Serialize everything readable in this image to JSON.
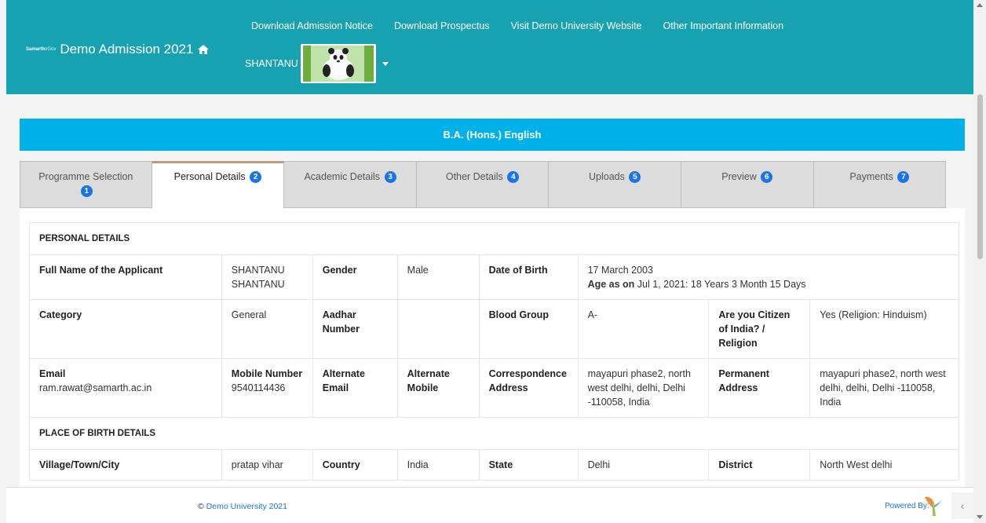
{
  "header": {
    "logo_prefix": "Samarth",
    "logo_suffix": "eGov",
    "title": "Demo Admission 2021",
    "nav": [
      "Download Admission Notice",
      "Download Prospectus",
      "Visit Demo University Website",
      "Other Important Information"
    ],
    "username": "SHANTANU"
  },
  "program": {
    "title": "B.A. (Hons.) English"
  },
  "tabs": [
    {
      "label": "Programme Selection",
      "badge": "1",
      "active": false
    },
    {
      "label": "Personal Details",
      "badge": "2",
      "active": true
    },
    {
      "label": "Academic Details",
      "badge": "3",
      "active": false
    },
    {
      "label": "Other Details",
      "badge": "4",
      "active": false
    },
    {
      "label": "Uploads",
      "badge": "5",
      "active": false
    },
    {
      "label": "Preview",
      "badge": "6",
      "active": false
    },
    {
      "label": "Payments",
      "badge": "7",
      "active": false
    }
  ],
  "personal": {
    "section_title": "PERSONAL DETAILS",
    "full_name_label": "Full Name of the Applicant",
    "full_name_value": "SHANTANU SHANTANU",
    "gender_label": "Gender",
    "gender_value": "Male",
    "dob_label": "Date of Birth",
    "dob_value": "17 March 2003",
    "age_label": "Age as on",
    "age_value": "Jul 1, 2021: 18 Years 3 Month 15 Days",
    "category_label": "Category",
    "category_value": "General",
    "aadhar_label": "Aadhar Number",
    "aadhar_value": "",
    "blood_label": "Blood Group",
    "blood_value": "A-",
    "citizen_label": "Are you Citizen of India? / Religion",
    "citizen_value": "Yes (Religion: Hinduism)",
    "email_label": "Email",
    "email_value": "ram.rawat@samarth.ac.in",
    "mobile_label": "Mobile Number",
    "mobile_value": "9540114436",
    "alt_email_label": "Alternate Email",
    "alt_mobile_label": "Alternate Mobile",
    "corr_label": "Correspondence Address",
    "corr_value": "mayapuri phase2, north west delhi, delhi, Delhi -110058, India",
    "perm_label": "Permanent Address",
    "perm_value": "mayapuri phase2, north west delhi, delhi, Delhi -110058, India"
  },
  "birth": {
    "section_title": "PLACE OF BIRTH DETAILS",
    "village_label": "Village/Town/City",
    "village_value": "pratap vihar",
    "country_label": "Country",
    "country_value": "India",
    "state_label": "State",
    "state_value": "Delhi",
    "district_label": "District",
    "district_value": "North West delhi"
  },
  "footer": {
    "copyright_symbol": "©",
    "copyright_text": "Demo University 2021",
    "powered_by": "Powered By:"
  },
  "colors": {
    "header_bg": "#17a2b1",
    "program_bar": "#00b0e8",
    "badge": "#1a73e8",
    "active_tab_border": "#b99b7e"
  }
}
